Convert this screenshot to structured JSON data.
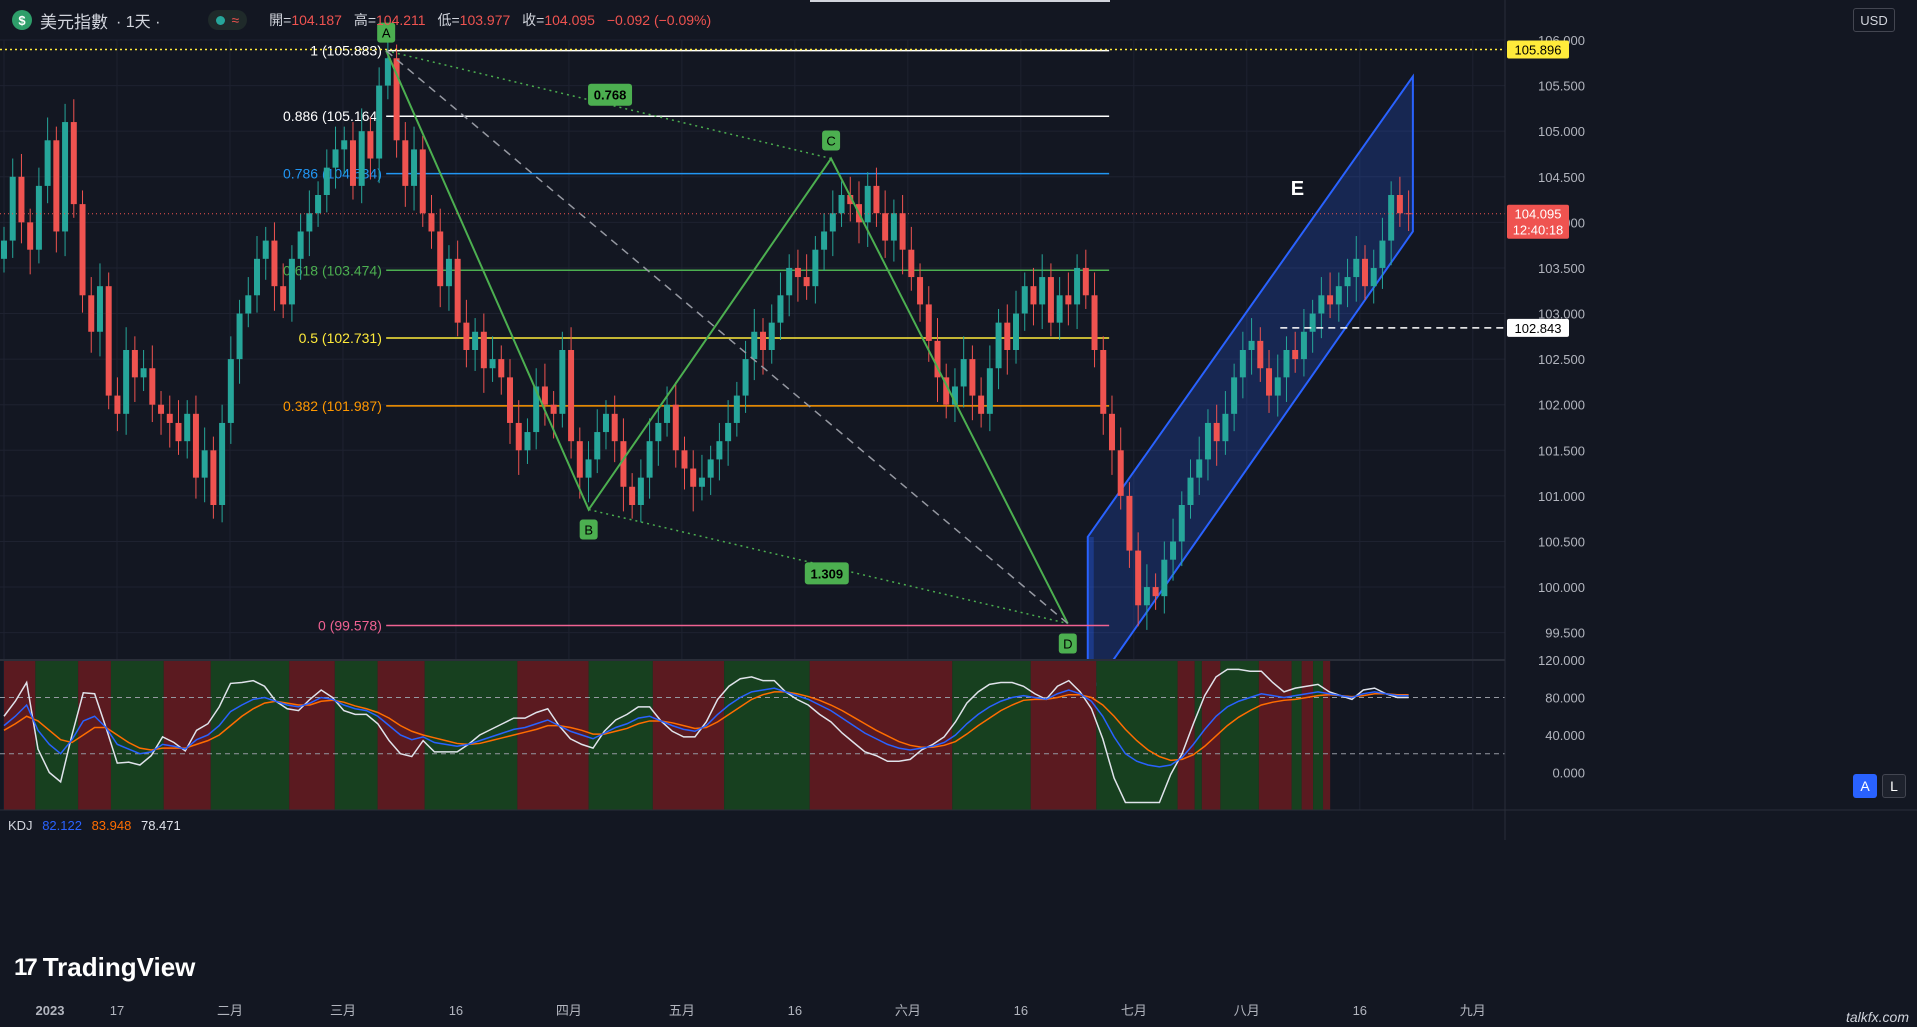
{
  "header": {
    "symbol_icon": "$",
    "symbol": "美元指數",
    "interval": "· 1天 ·",
    "status_icon": "wave-icon",
    "ohlc": [
      {
        "k": "開=",
        "v": "104.187"
      },
      {
        "k": "高=",
        "v": "104.211"
      },
      {
        "k": "低=",
        "v": "103.977"
      },
      {
        "k": "收=",
        "v": "104.095"
      },
      {
        "k": "",
        "v": "−0.092 (−0.09%)"
      }
    ],
    "currency_button": "USD"
  },
  "colors": {
    "up": "#26a69a",
    "down": "#ef5350",
    "pattern": "#4caf50",
    "channel": "#2962ff"
  },
  "chart_data": [
    {
      "type": "candlestick",
      "title": "美元指數 · 1天",
      "ylim": [
        99.2,
        106.0
      ],
      "y_ticks": [
        "106.000",
        "105.500",
        "105.000",
        "104.500",
        "104.000",
        "103.500",
        "103.000",
        "102.500",
        "102.000",
        "101.500",
        "101.000",
        "100.500",
        "100.000",
        "99.500"
      ],
      "x_ticks": [
        "2023",
        "17",
        "二月",
        "三月",
        "16",
        "四月",
        "五月",
        "16",
        "六月",
        "16",
        "七月",
        "八月",
        "16",
        "九月"
      ],
      "price_labels": [
        {
          "label": "105.896",
          "value": 105.896,
          "color": "#ffeb3b",
          "text_color": "#000000"
        },
        {
          "label": "104.095",
          "value": 104.095,
          "color": "#ef5350",
          "text_color": "#ffffff",
          "sub": "12:40:18"
        },
        {
          "label": "102.843",
          "value": 102.843,
          "color": "#ffffff",
          "text_color": "#000000"
        }
      ],
      "fib_levels": [
        {
          "ratio": "1",
          "price": 105.883,
          "label": "1 (105.883)",
          "color": "#ffffff"
        },
        {
          "ratio": "0.886",
          "price": 105.164,
          "label": "0.886 (105.164)",
          "color": "#ffffff"
        },
        {
          "ratio": "0.786",
          "price": 104.534,
          "label": "0.786 (104.534)",
          "color": "#2196f3"
        },
        {
          "ratio": "0.618",
          "price": 103.474,
          "label": "0.618 (103.474)",
          "color": "#4caf50"
        },
        {
          "ratio": "0.5",
          "price": 102.731,
          "label": "0.5 (102.731)",
          "color": "#ffeb3b"
        },
        {
          "ratio": "0.382",
          "price": 101.987,
          "label": "0.382 (101.987)",
          "color": "#ff9800"
        },
        {
          "ratio": "0",
          "price": 99.578,
          "label": "0 (99.578)",
          "color": "#f06292"
        }
      ],
      "pattern_points": [
        {
          "label": "A",
          "t": 0.268,
          "price": 105.883
        },
        {
          "label": "B",
          "t": 0.41,
          "price": 100.85
        },
        {
          "label": "C",
          "t": 0.58,
          "price": 104.7
        },
        {
          "label": "D",
          "t": 0.746,
          "price": 99.6
        }
      ],
      "pattern_ratios": [
        {
          "label": "0.768",
          "t": 0.425,
          "price": 105.4
        },
        {
          "label": "1.309",
          "t": 0.577,
          "price": 100.15
        }
      ],
      "wave_label": {
        "label": "E",
        "t": 0.907,
        "price": 104.3
      },
      "close_series": [
        103.8,
        104.5,
        104.0,
        103.7,
        104.4,
        104.9,
        103.9,
        105.1,
        104.2,
        103.2,
        102.8,
        103.3,
        102.1,
        101.9,
        102.6,
        102.3,
        102.4,
        102.0,
        101.9,
        101.8,
        101.6,
        101.9,
        101.2,
        101.5,
        100.9,
        101.8,
        102.5,
        103.0,
        103.2,
        103.6,
        103.8,
        103.3,
        103.1,
        103.6,
        103.9,
        104.1,
        104.3,
        104.6,
        104.8,
        104.9,
        104.4,
        105.0,
        104.7,
        105.5,
        105.8,
        104.9,
        104.4,
        104.8,
        104.1,
        103.9,
        103.3,
        103.6,
        102.9,
        102.6,
        102.8,
        102.4,
        102.5,
        102.3,
        101.8,
        101.5,
        101.7,
        102.2,
        102.0,
        101.9,
        102.6,
        101.6,
        101.2,
        101.4,
        101.7,
        101.9,
        101.6,
        101.1,
        100.9,
        101.2,
        101.6,
        101.8,
        102.0,
        101.5,
        101.3,
        101.1,
        101.2,
        101.4,
        101.6,
        101.8,
        102.1,
        102.5,
        102.8,
        102.6,
        102.9,
        103.2,
        103.5,
        103.4,
        103.3,
        103.7,
        103.9,
        104.1,
        104.3,
        104.2,
        104.0,
        104.4,
        104.1,
        103.8,
        104.1,
        103.7,
        103.4,
        103.1,
        102.7,
        102.3,
        102.0,
        102.2,
        102.5,
        102.1,
        101.9,
        102.4,
        102.9,
        102.6,
        103.0,
        103.3,
        103.1,
        103.4,
        102.9,
        103.2,
        103.1,
        103.5,
        103.2,
        102.6,
        101.9,
        101.5,
        101.0,
        100.4,
        99.8,
        100.0,
        99.9,
        100.3,
        100.5,
        100.9,
        101.2,
        101.4,
        101.8,
        101.6,
        101.9,
        102.3,
        102.6,
        102.7,
        102.4,
        102.1,
        102.3,
        102.6,
        102.5,
        102.8,
        103.0,
        103.2,
        103.1,
        103.3,
        103.4,
        103.6,
        103.3,
        103.5,
        103.8,
        104.3,
        104.1,
        104.095
      ]
    },
    {
      "type": "line",
      "title": "KDJ",
      "ylim": [
        -40,
        120
      ],
      "y_ticks": [
        "120.000",
        "80.000",
        "40.000",
        "0.000"
      ],
      "legend": [
        {
          "name": "KDJ",
          "value": ""
        },
        {
          "name": "K",
          "value": "82.122"
        },
        {
          "name": "D",
          "value": "83.948"
        },
        {
          "name": "J",
          "value": "78.471"
        }
      ],
      "k_series": [
        50,
        60,
        72,
        45,
        30,
        20,
        35,
        55,
        60,
        48,
        30,
        25,
        20,
        22,
        30,
        28,
        25,
        35,
        40,
        50,
        65,
        72,
        78,
        80,
        76,
        72,
        70,
        74,
        80,
        78,
        72,
        68,
        66,
        60,
        50,
        40,
        35,
        38,
        32,
        30,
        28,
        30,
        34,
        38,
        42,
        46,
        48,
        52,
        56,
        50,
        44,
        40,
        36,
        42,
        48,
        52,
        58,
        60,
        55,
        50,
        46,
        44,
        50,
        62,
        72,
        80,
        86,
        88,
        90,
        86,
        82,
        78,
        72,
        66,
        58,
        50,
        42,
        36,
        30,
        26,
        24,
        26,
        28,
        32,
        40,
        52,
        62,
        70,
        76,
        80,
        82,
        80,
        78,
        84,
        88,
        84,
        76,
        60,
        38,
        20,
        12,
        8,
        6,
        8,
        16,
        30,
        46,
        60,
        70,
        76,
        80,
        84,
        82,
        80,
        82,
        84,
        86,
        84,
        82,
        80,
        84,
        86,
        84,
        82,
        82
      ],
      "d_series": [
        45,
        52,
        60,
        55,
        45,
        35,
        32,
        40,
        48,
        48,
        40,
        32,
        26,
        24,
        26,
        26,
        26,
        30,
        34,
        40,
        50,
        60,
        68,
        74,
        76,
        74,
        72,
        72,
        76,
        77,
        75,
        71,
        68,
        64,
        58,
        50,
        44,
        40,
        37,
        34,
        31,
        30,
        31,
        34,
        37,
        40,
        43,
        46,
        50,
        50,
        48,
        45,
        41,
        41,
        44,
        47,
        52,
        55,
        55,
        53,
        50,
        47,
        48,
        54,
        62,
        70,
        78,
        83,
        86,
        86,
        84,
        81,
        77,
        72,
        66,
        59,
        52,
        45,
        39,
        33,
        29,
        27,
        27,
        29,
        33,
        41,
        50,
        58,
        66,
        72,
        77,
        78,
        78,
        80,
        83,
        83,
        80,
        72,
        60,
        46,
        34,
        24,
        17,
        13,
        14,
        19,
        28,
        39,
        50,
        59,
        66,
        72,
        75,
        77,
        78,
        80,
        82,
        83,
        82,
        81,
        82,
        84,
        84,
        83,
        83
      ],
      "j_series": [
        60,
        76,
        96,
        25,
        0,
        -10,
        40,
        85,
        84,
        48,
        10,
        11,
        8,
        18,
        38,
        32,
        23,
        45,
        52,
        70,
        95,
        96,
        98,
        92,
        76,
        68,
        66,
        78,
        88,
        80,
        66,
        62,
        62,
        52,
        34,
        20,
        17,
        34,
        22,
        22,
        22,
        30,
        40,
        46,
        52,
        58,
        58,
        64,
        68,
        50,
        36,
        30,
        26,
        44,
        56,
        62,
        70,
        70,
        55,
        44,
        38,
        38,
        54,
        78,
        92,
        100,
        102,
        98,
        98,
        86,
        78,
        72,
        62,
        54,
        42,
        32,
        22,
        18,
        12,
        12,
        14,
        24,
        30,
        38,
        54,
        74,
        86,
        94,
        96,
        96,
        92,
        84,
        78,
        92,
        98,
        86,
        68,
        36,
        -6,
        -32,
        -32,
        -32,
        -32,
        -2,
        20,
        52,
        82,
        102,
        110,
        110,
        108,
        108,
        96,
        86,
        90,
        92,
        94,
        86,
        82,
        78,
        88,
        90,
        84,
        80,
        80
      ],
      "zones": [
        [
          0.0,
          0.022,
          "r"
        ],
        [
          0.022,
          0.052,
          "g"
        ],
        [
          0.052,
          0.075,
          "r"
        ],
        [
          0.075,
          0.112,
          "g"
        ],
        [
          0.112,
          0.145,
          "r"
        ],
        [
          0.145,
          0.2,
          "g"
        ],
        [
          0.2,
          0.232,
          "r"
        ],
        [
          0.232,
          0.262,
          "g"
        ],
        [
          0.262,
          0.295,
          "r"
        ],
        [
          0.295,
          0.36,
          "g"
        ],
        [
          0.36,
          0.41,
          "r"
        ],
        [
          0.41,
          0.455,
          "g"
        ],
        [
          0.455,
          0.505,
          "r"
        ],
        [
          0.505,
          0.565,
          "g"
        ],
        [
          0.565,
          0.665,
          "r"
        ],
        [
          0.665,
          0.72,
          "g"
        ],
        [
          0.72,
          0.766,
          "r"
        ],
        [
          0.766,
          0.823,
          "g"
        ],
        [
          0.823,
          0.835,
          "r"
        ],
        [
          0.835,
          0.84,
          "g"
        ],
        [
          0.84,
          0.853,
          "r"
        ],
        [
          0.853,
          0.88,
          "g"
        ],
        [
          0.88,
          0.903,
          "r"
        ],
        [
          0.903,
          0.91,
          "g"
        ],
        [
          0.91,
          0.918,
          "r"
        ],
        [
          0.918,
          0.925,
          "g"
        ],
        [
          0.925,
          0.93,
          "r"
        ]
      ]
    }
  ],
  "branding": {
    "logo": "TradingView",
    "watermark": "talkfx.com",
    "scale_buttons": [
      "A",
      "L"
    ]
  }
}
